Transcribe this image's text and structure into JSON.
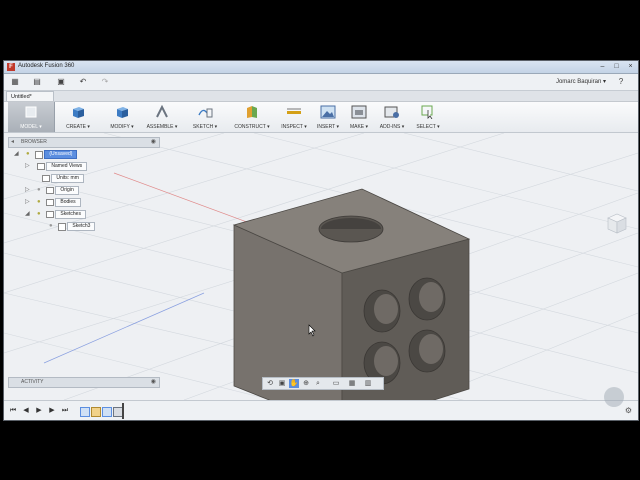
{
  "window": {
    "title": "Autodesk Fusion 360",
    "app_icon": "F"
  },
  "quick_access": {
    "grid_icon": "grid-icon",
    "file_icon": "file-icon",
    "save_icon": "save-icon",
    "undo_icon": "undo-icon",
    "redo_icon": "redo-icon",
    "user_name": "Jomarc Baquiran ▾",
    "help_icon": "help-icon"
  },
  "document_tab": {
    "label": "Untitled*"
  },
  "ribbon": {
    "workspace": "MODEL ▾",
    "tools": [
      {
        "key": "create",
        "label": "CREATE ▾"
      },
      {
        "key": "modify",
        "label": "MODIFY ▾"
      },
      {
        "key": "assemble",
        "label": "ASSEMBLE ▾"
      },
      {
        "key": "sketch",
        "label": "SKETCH ▾"
      },
      {
        "key": "construct",
        "label": "CONSTRUCT ▾"
      },
      {
        "key": "inspect",
        "label": "INSPECT ▾"
      },
      {
        "key": "insert",
        "label": "INSERT ▾"
      },
      {
        "key": "make",
        "label": "MAKE ▾"
      },
      {
        "key": "addins",
        "label": "ADD-INS ▾"
      },
      {
        "key": "select",
        "label": "SELECT ▾"
      }
    ]
  },
  "browser": {
    "header": "BROWSER",
    "items": {
      "root": "(Unsaved)",
      "named_views": "Named Views",
      "units": "Units: mm",
      "origin": "Origin",
      "bodies": "Bodies",
      "sketches": "Sketches",
      "sketch3": "Sketch3"
    }
  },
  "activity": {
    "label": "ACTIVITY"
  },
  "colors": {
    "body_front": "#75706b",
    "body_top": "#86827d",
    "body_side": "#5c5853",
    "selected": "#5b8ee0"
  }
}
